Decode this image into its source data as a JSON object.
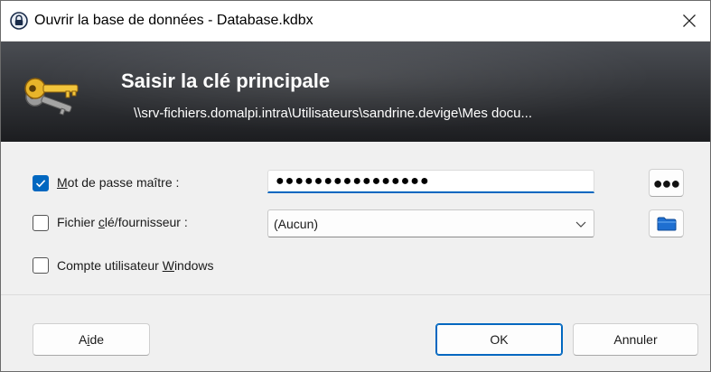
{
  "window": {
    "title": "Ouvrir la base de données - Database.kdbx",
    "app_icon": "lock-icon",
    "close_icon": "close-icon"
  },
  "banner": {
    "title": "Saisir la clé principale",
    "path": "\\\\srv-fichiers.domalpi.intra\\Utilisateurs\\sandrine.devige\\Mes docu...",
    "icon": "key-icon"
  },
  "master_password": {
    "checked": true,
    "label_pre": "",
    "label_accel": "M",
    "label_post": "ot de passe maître :",
    "value_masked": "●●●●●●●●●●●●●●●●",
    "reveal_button_glyph": "●●●"
  },
  "key_file": {
    "checked": false,
    "label_pre": "Fichier ",
    "label_accel": "c",
    "label_post": "lé/fournisseur :",
    "selected": "(Aucun)",
    "browse_icon": "folder-icon"
  },
  "windows_account": {
    "checked": false,
    "label_pre": "Compte utilisateur ",
    "label_accel": "W",
    "label_post": "indows"
  },
  "buttons": {
    "help_pre": "A",
    "help_accel": "i",
    "help_post": "de",
    "ok": "OK",
    "cancel": "Annuler"
  },
  "colors": {
    "accent": "#0067c0",
    "banner_dark": "#2b2d31"
  }
}
